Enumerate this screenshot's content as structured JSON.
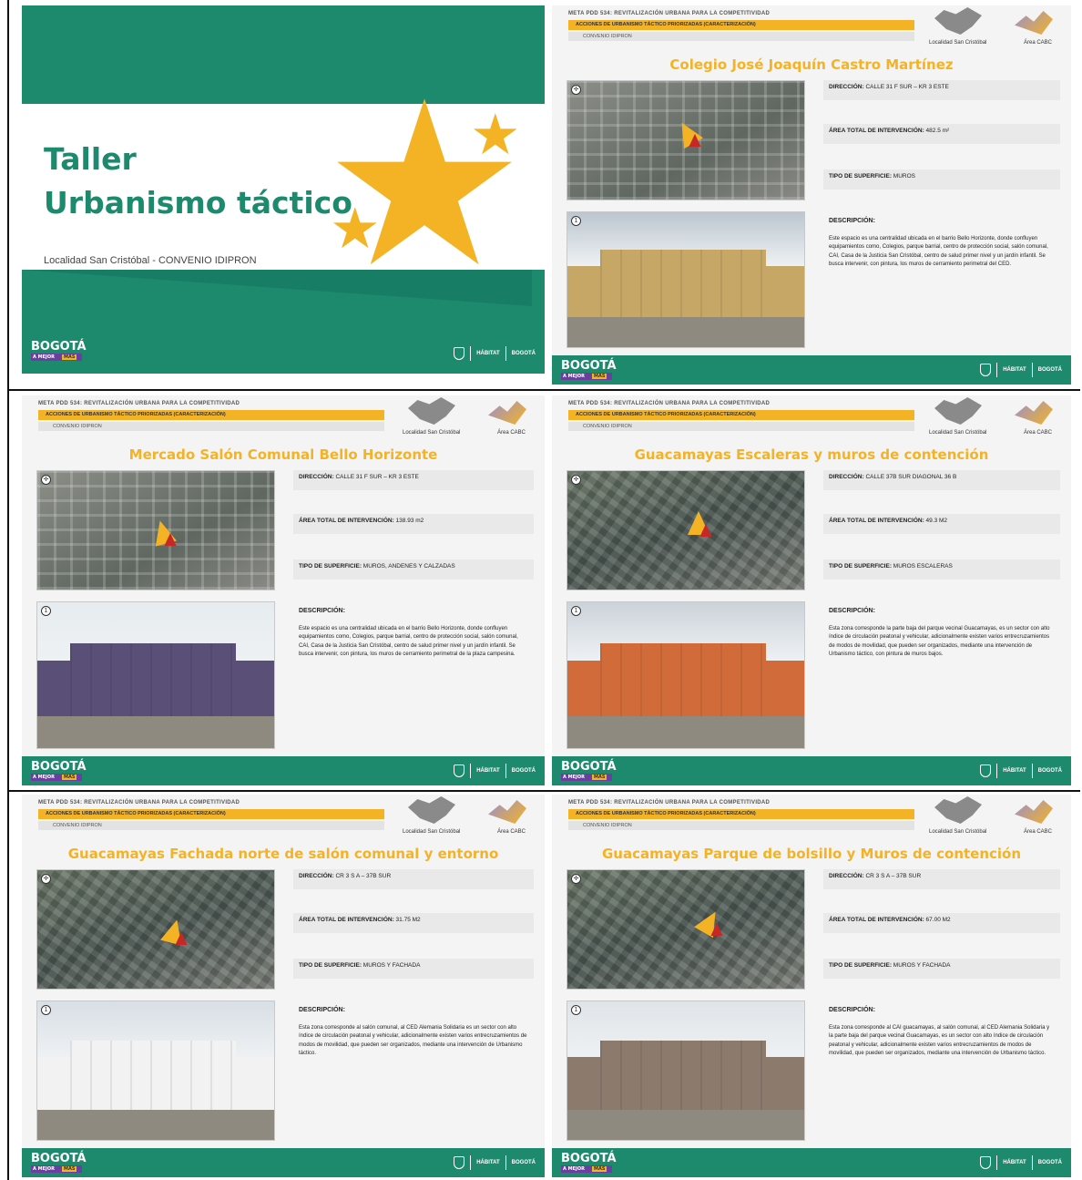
{
  "cover": {
    "title_line1": "Taller",
    "title_line2": "Urbanismo táctico",
    "subtitle": "Localidad San Cristóbal - CONVENIO IDIPRON",
    "bogota_logo": "BOGOTÁ",
    "bogota_tag_a": "A MEJOR",
    "bogota_tag_b": "MÁS",
    "habitat_logo": "HÁBITAT",
    "bogota_mark": "BOGOTÁ"
  },
  "common": {
    "meta": "META PDD 534: REVITALIZACIÓN URBANA PARA LA COMPETITIVIDAD",
    "section": "ACCIONES DE URBANISMO TÁCTICO PRIORIZADAS (CARACTERIZACIÓN)",
    "convenio": "CONVENIO IDIPRON",
    "localidad_label": "Localidad San Cristóbal",
    "area_label": "Área CABC",
    "direccion_label": "DIRECCIÓN:",
    "area_total_label": "ÁREA TOTAL DE INTERVENCIÓN:",
    "tipo_label": "TIPO DE SUPERFICIE:",
    "descripcion_label": "DESCRIPCIÓN:"
  },
  "slides": [
    {
      "title": "Colegio José Joaquín Castro Martínez",
      "direccion": "CALLE 31 F SUR – KR 3 ESTE",
      "area": "482.5 m²",
      "tipo": "MUROS",
      "descripcion": "Este espacio es una centralidad ubicada en el barrio Bello Horizonte, donde confluyen equipamientos como, Colegios, parque barrial, centro de protección social, salón comunal, CAI, Casa de la Justicia San Cristóbal, centro de salud primer nivel y un jardín infantil. Se busca intervenir, con pintura, los muros de cerramiento perimetral del CED."
    },
    {
      "title": "Mercado Salón Comunal Bello Horizonte",
      "direccion": "CALLE 31 F SUR – KR 3 ESTE",
      "area": "138.93 m2",
      "tipo": "MUROS, ANDENES Y CALZADAS",
      "descripcion": "Este espacio es una centralidad ubicada en el barrio Bello Horizonte, donde confluyen equipamientos como, Colegios, parque barrial, centro de protección social, salón comunal, CAI, Casa de la Justicia San Cristóbal, centro de salud primer nivel y un jardín infantil. Se busca intervenir, con pintura, los muros de cerramiento perimetral de la plaza campesina."
    },
    {
      "title": "Guacamayas Escaleras y muros de contención",
      "direccion": "CALLE 37B SUR DIAGONAL 36 B",
      "area": "49.3 M2",
      "tipo": "MUROS ESCALERAS",
      "descripcion": "Esta zona corresponde la parte baja del parque vecinal Guacamayas, es un sector con alto índice de circulación peatonal y vehicular, adicionalmente existen varios entrecruzamientos de modos de movilidad, que pueden ser organizados, mediante una intervención de Urbanismo táctico, con pintura de muros bajos."
    },
    {
      "title": "Guacamayas Fachada norte de salón comunal y entorno",
      "direccion": "CR 3 S A – 37B SUR",
      "area": "31.75 M2",
      "tipo": "MUROS Y FACHADA",
      "descripcion": "Esta zona corresponde al salón comunal, al CED Alemania Solidaria es un sector con alto índice de circulación peatonal y vehicular, adicionalmente existen varios entrecruzamientos de modos de movilidad, que pueden ser organizados, mediante una intervención de Urbanismo táctico."
    },
    {
      "title": "Guacamayas Parque de bolsillo y Muros de contención",
      "direccion": "CR 3 S A – 37B SUR",
      "area": "67.00 M2",
      "tipo": "MUROS Y FACHADA",
      "descripcion": "Esta zona corresponde al CAI guacamayas, al salón comunal, al CED Alemania Solidaria y la parte baja del parque vecinal Guacamayas, es un sector con alto índice de circulación peatonal y vehicular, adicionalmente existen varios entrecruzamientos de modos de movilidad, que pueden ser organizados, mediante una intervención de Urbanismo táctico."
    }
  ]
}
